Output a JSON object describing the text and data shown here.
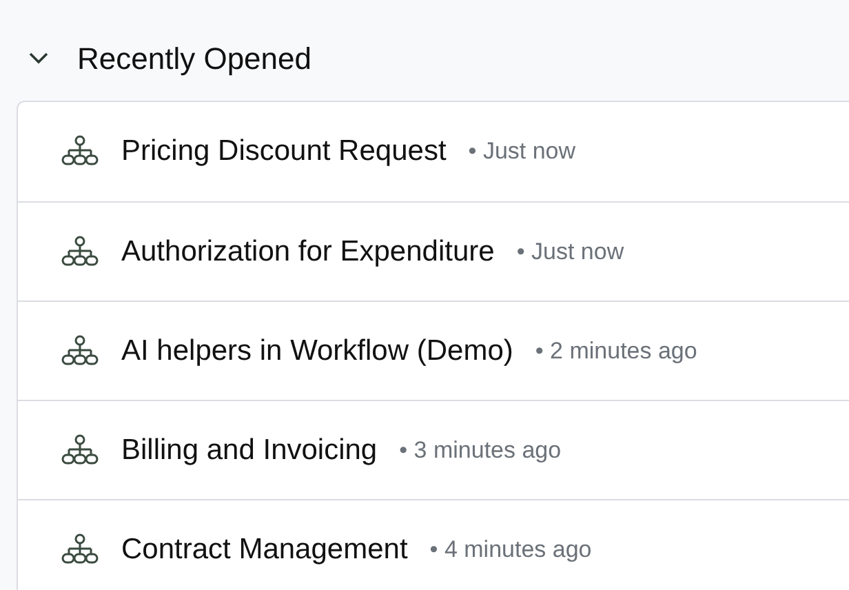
{
  "section": {
    "title": "Recently Opened",
    "expanded": true
  },
  "items": [
    {
      "name": "Pricing Discount Request",
      "meta": "• Just now"
    },
    {
      "name": "Authorization for Expenditure",
      "meta": "• Just now"
    },
    {
      "name": "AI helpers in Workflow (Demo)",
      "meta": "• 2 minutes ago"
    },
    {
      "name": "Billing and Invoicing",
      "meta": "• 3 minutes ago"
    },
    {
      "name": "Contract Management",
      "meta": "• 4 minutes ago"
    }
  ]
}
